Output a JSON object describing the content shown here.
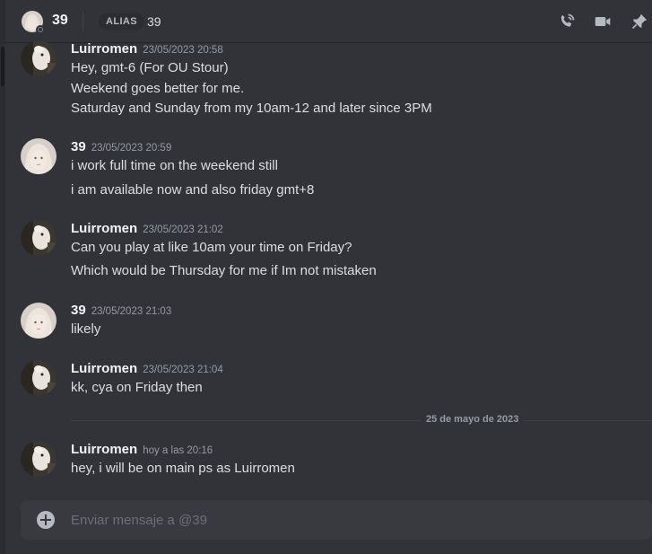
{
  "header": {
    "title": "39",
    "alias_label": "ALIAS",
    "alias_value": "39",
    "icons": [
      "call-icon",
      "video-icon",
      "pin-icon"
    ]
  },
  "messages": [
    {
      "author": "Luirromen",
      "timestamp": "23/05/2023 20:58",
      "avatar": "dog-avatar",
      "lines": [
        "Hey, gmt-6 (For OU Stour)",
        "Weekend goes better for me.",
        "Saturday and Sunday from my 10am-12 and later since 3PM"
      ]
    },
    {
      "author": "39",
      "timestamp": "23/05/2023 20:59",
      "avatar": "girl-avatar",
      "lines": [
        "i work full time on the weekend still",
        "i am available now and also friday gmt+8"
      ]
    },
    {
      "author": "Luirromen",
      "timestamp": "23/05/2023 21:02",
      "avatar": "dog-avatar",
      "lines": [
        "Can you play at like 10am your time on Friday?",
        "Which would be Thursday for me if Im not mistaken"
      ]
    },
    {
      "author": "39",
      "timestamp": "23/05/2023 21:03",
      "avatar": "girl-avatar",
      "lines": [
        "likely"
      ]
    },
    {
      "author": "Luirromen",
      "timestamp": "23/05/2023 21:04",
      "avatar": "dog-avatar",
      "lines": [
        "kk, cya on Friday then"
      ]
    },
    {
      "author": "Luirromen",
      "timestamp": "hoy a las 20:16",
      "avatar": "dog-avatar",
      "lines": [
        "hey, i will be on main ps as Luirromen"
      ]
    }
  ],
  "date_separator": "25 de mayo de 2023",
  "composer": {
    "placeholder": "Enviar mensaje a @39"
  },
  "colors": {
    "background": "#313338",
    "composer": "#383a40",
    "author": "#f2f3f5",
    "timestamp": "#949ba4"
  }
}
